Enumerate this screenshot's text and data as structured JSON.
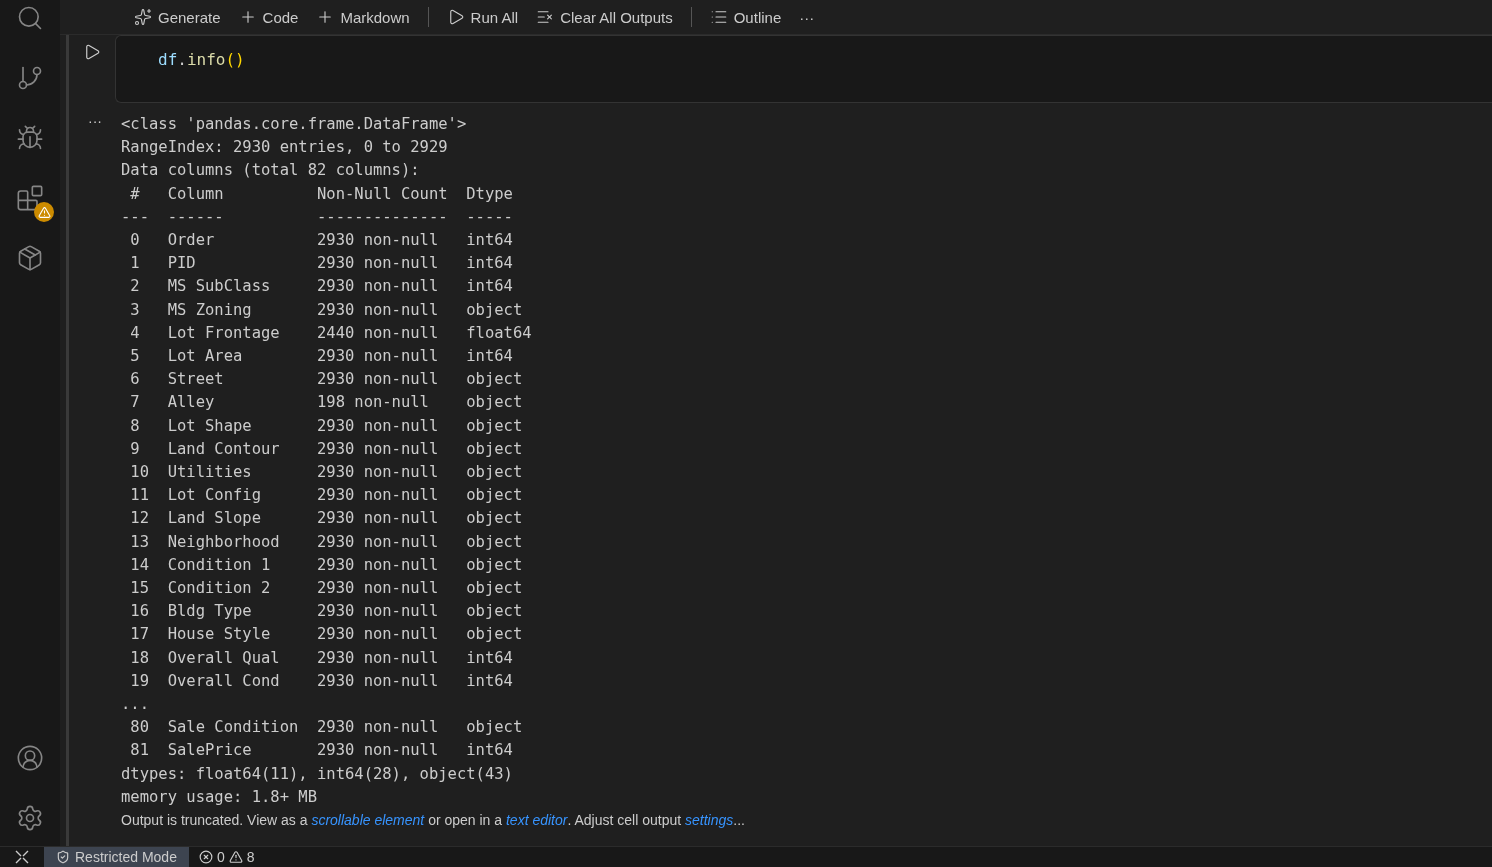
{
  "activity_bar": {
    "top": [
      {
        "kind": "search"
      },
      {
        "kind": "source-control"
      },
      {
        "kind": "run-debug"
      },
      {
        "kind": "extensions",
        "warning": true
      },
      {
        "kind": "container"
      }
    ],
    "bottom": [
      {
        "kind": "account"
      },
      {
        "kind": "settings"
      }
    ]
  },
  "toolbar": {
    "items": [
      {
        "kind": "sparkle",
        "label": "Generate"
      },
      {
        "kind": "plus",
        "label": "Code"
      },
      {
        "kind": "plus",
        "label": "Markdown"
      },
      {
        "kind": "separator"
      },
      {
        "kind": "run",
        "label": "Run All"
      },
      {
        "kind": "clear",
        "label": "Clear All Outputs"
      },
      {
        "kind": "separator"
      },
      {
        "kind": "outline",
        "label": "Outline"
      },
      {
        "kind": "more",
        "label": "···"
      }
    ]
  },
  "cell": {
    "tokens": [
      {
        "kind": "variable",
        "text": "df"
      },
      {
        "kind": "plain",
        "text": "."
      },
      {
        "kind": "function",
        "text": "info"
      },
      {
        "kind": "bracket",
        "text": "()"
      }
    ]
  },
  "output": {
    "menu": "···",
    "lines": [
      "<class 'pandas.core.frame.DataFrame'>",
      "RangeIndex: 2930 entries, 0 to 2929",
      "Data columns (total 82 columns):",
      " #   Column          Non-Null Count  Dtype  ",
      "---  ------          --------------  -----  ",
      " 0   Order           2930 non-null   int64  ",
      " 1   PID             2930 non-null   int64  ",
      " 2   MS SubClass     2930 non-null   int64  ",
      " 3   MS Zoning       2930 non-null   object ",
      " 4   Lot Frontage    2440 non-null   float64",
      " 5   Lot Area        2930 non-null   int64  ",
      " 6   Street          2930 non-null   object ",
      " 7   Alley           198 non-null    object ",
      " 8   Lot Shape       2930 non-null   object ",
      " 9   Land Contour    2930 non-null   object ",
      " 10  Utilities       2930 non-null   object ",
      " 11  Lot Config      2930 non-null   object ",
      " 12  Land Slope      2930 non-null   object ",
      " 13  Neighborhood    2930 non-null   object ",
      " 14  Condition 1     2930 non-null   object ",
      " 15  Condition 2     2930 non-null   object ",
      " 16  Bldg Type       2930 non-null   object ",
      " 17  House Style     2930 non-null   object ",
      " 18  Overall Qual    2930 non-null   int64  ",
      " 19  Overall Cond    2930 non-null   int64  ",
      "...",
      " 80  Sale Condition  2930 non-null   object ",
      " 81  SalePrice       2930 non-null   int64  ",
      "dtypes: float64(11), int64(28), object(43)",
      "memory usage: 1.8+ MB"
    ],
    "notice": [
      {
        "kind": "text",
        "text": "Output is truncated. View as a "
      },
      {
        "kind": "link",
        "text": "scrollable element"
      },
      {
        "kind": "text",
        "text": " or open in a "
      },
      {
        "kind": "link",
        "text": "text editor"
      },
      {
        "kind": "text",
        "text": ". Adjust cell output "
      },
      {
        "kind": "link",
        "text": "settings"
      },
      {
        "kind": "text",
        "text": "..."
      }
    ]
  },
  "status_bar": {
    "restricted_mode": "Restricted Mode",
    "errors": "0",
    "warnings": "8"
  }
}
